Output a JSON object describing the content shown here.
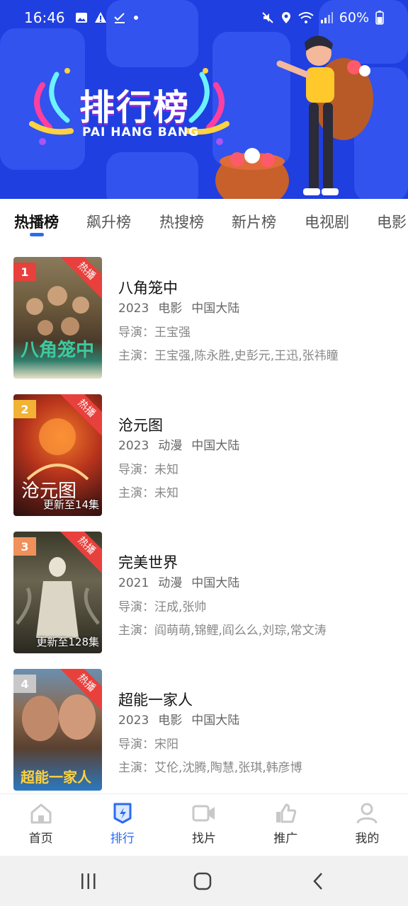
{
  "status_bar": {
    "time": "16:46",
    "battery": "60%",
    "icons": [
      "image-icon",
      "warning-icon",
      "check-icon",
      "dot-icon",
      "mute-icon",
      "location-icon",
      "wifi-icon",
      "signal-icon",
      "battery-icon"
    ]
  },
  "banner": {
    "title": "排行榜",
    "subtitle": "PAI HANG BANG"
  },
  "tabs": [
    {
      "label": "热播榜",
      "active": true
    },
    {
      "label": "飙升榜",
      "active": false
    },
    {
      "label": "热搜榜",
      "active": false
    },
    {
      "label": "新片榜",
      "active": false
    },
    {
      "label": "电视剧",
      "active": false
    },
    {
      "label": "电影",
      "active": false
    }
  ],
  "items": [
    {
      "rank": "1",
      "badge": "热播",
      "poster_caption": "",
      "title": "八角笼中",
      "year": "2023",
      "genre": "电影",
      "region": "中国大陆",
      "director": "导演：王宝强",
      "cast": "主演：王宝强,陈永胜,史彭元,王迅,张祎瞳"
    },
    {
      "rank": "2",
      "badge": "热播",
      "poster_caption": "更新至14集",
      "title": "沧元图",
      "year": "2023",
      "genre": "动漫",
      "region": "中国大陆",
      "director": "导演：未知",
      "cast": "主演：未知"
    },
    {
      "rank": "3",
      "badge": "热播",
      "poster_caption": "更新至128集",
      "title": "完美世界",
      "year": "2021",
      "genre": "动漫",
      "region": "中国大陆",
      "director": "导演：汪成,张帅",
      "cast": "主演：阎萌萌,锦鲤,阎么么,刘琮,常文涛"
    },
    {
      "rank": "4",
      "badge": "热播",
      "poster_caption": "",
      "title": "超能一家人",
      "year": "2023",
      "genre": "电影",
      "region": "中国大陆",
      "director": "导演：宋阳",
      "cast": "主演：艾伦,沈腾,陶慧,张琪,韩彦博"
    }
  ],
  "bottom_nav": [
    {
      "label": "首页",
      "icon": "home-icon",
      "active": false
    },
    {
      "label": "排行",
      "icon": "ranking-icon",
      "active": true
    },
    {
      "label": "找片",
      "icon": "video-camera-icon",
      "active": false
    },
    {
      "label": "推广",
      "icon": "thumbs-up-icon",
      "active": false
    },
    {
      "label": "我的",
      "icon": "user-icon",
      "active": false
    }
  ],
  "colors": {
    "banner_blue": "#1f3fe0",
    "accent_blue": "#2a6cf0",
    "ribbon_red": "#e8403c",
    "rank_colors": [
      "#e8403c",
      "#f2b233",
      "#f0905a",
      "#c8c8c8"
    ]
  }
}
